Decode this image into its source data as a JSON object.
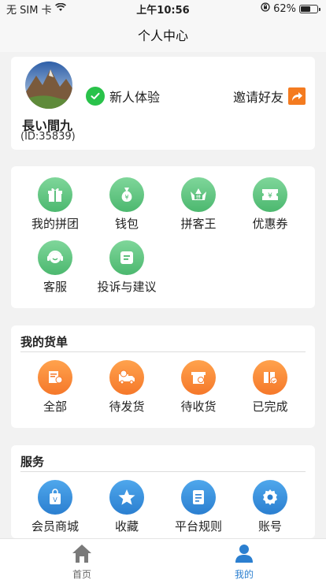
{
  "status": {
    "carrier": "无 SIM 卡",
    "time": "上午10:56",
    "battery": "62%",
    "battery_level": 0.62
  },
  "nav": {
    "title": "个人中心"
  },
  "profile": {
    "username": "長い間九",
    "id": "(ID:35839)",
    "badge_label": "新人体验",
    "invite_label": "邀请好友"
  },
  "features": [
    {
      "label": "我的拼团",
      "icon": "gift-icon",
      "glyph": "🎁"
    },
    {
      "label": "钱包",
      "icon": "money-bag-icon",
      "glyph": "¥"
    },
    {
      "label": "拼客王",
      "icon": "crown-icon",
      "glyph": "♛"
    },
    {
      "label": "优惠券",
      "icon": "coupon-icon",
      "glyph": "¥"
    },
    {
      "label": "客服",
      "icon": "headset-icon",
      "glyph": "☺"
    },
    {
      "label": "投诉与建议",
      "icon": "chat-icon",
      "glyph": "≡"
    }
  ],
  "orders": {
    "title": "我的货单",
    "items": [
      {
        "label": "全部",
        "icon": "all-orders-icon",
        "glyph": "▤"
      },
      {
        "label": "待发货",
        "icon": "truck-icon",
        "glyph": "⛟"
      },
      {
        "label": "待收货",
        "icon": "receive-icon",
        "glyph": "▣"
      },
      {
        "label": "已完成",
        "icon": "box-check-icon",
        "glyph": "✔"
      }
    ]
  },
  "services": {
    "title": "服务",
    "items": [
      {
        "label": "会员商城",
        "icon": "shopping-bag-icon",
        "glyph": "V"
      },
      {
        "label": "收藏",
        "icon": "star-icon",
        "glyph": "★"
      },
      {
        "label": "平台规则",
        "icon": "document-icon",
        "glyph": "≣"
      },
      {
        "label": "账号",
        "icon": "gear-icon",
        "glyph": "⚙"
      }
    ]
  },
  "tabbar": {
    "items": [
      {
        "label": "首页",
        "icon": "home-icon",
        "active": false
      },
      {
        "label": "我的",
        "icon": "user-icon",
        "active": true
      }
    ],
    "active_color": "#2b7fd0",
    "inactive_color": "#666666"
  }
}
